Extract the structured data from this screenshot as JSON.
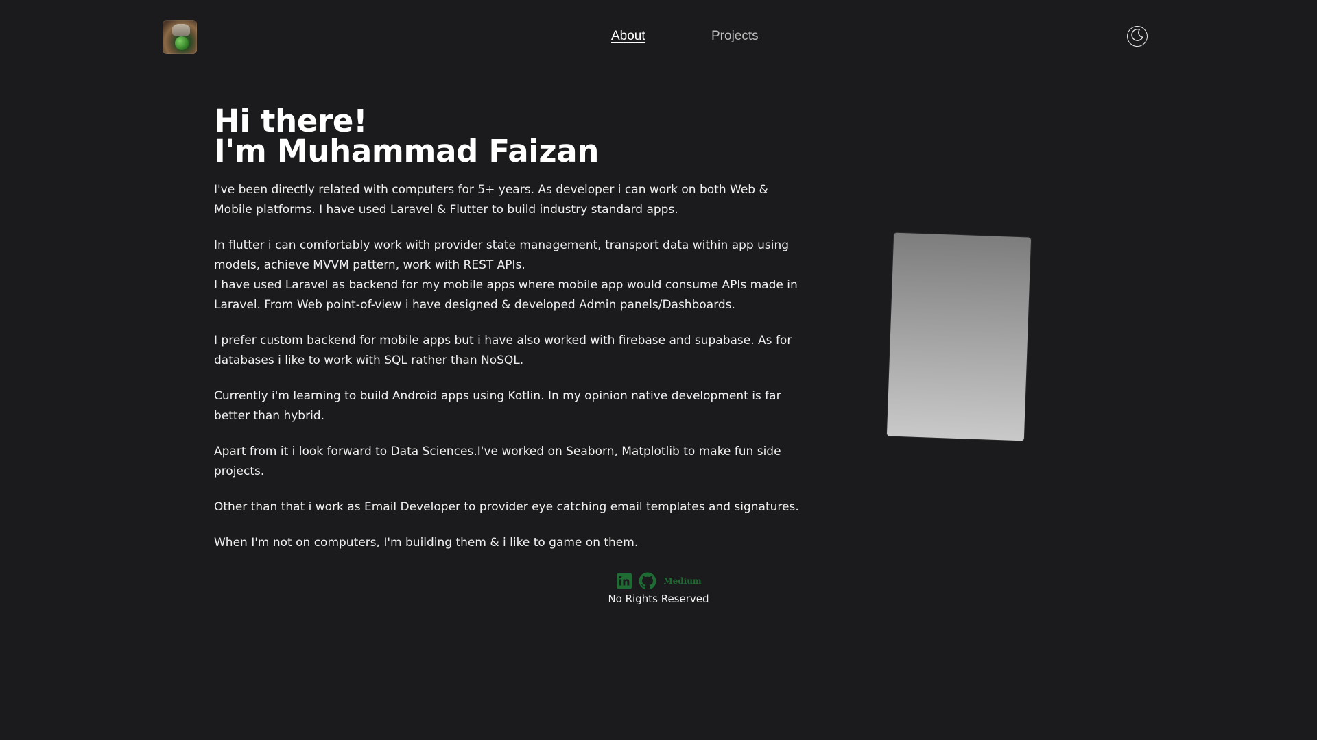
{
  "header": {
    "nav": {
      "about_label": "About",
      "projects_label": "Projects"
    }
  },
  "main": {
    "greeting_line1": "Hi there!",
    "greeting_line2": "I'm Muhammad Faizan",
    "paragraphs": [
      "I've been directly related with computers for 5+ years. As developer i can work on both Web & Mobile platforms. I have used Laravel & Flutter to build industry standard apps.",
      "In flutter i can comfortably work with provider state management, transport data within app using models, achieve MVVM pattern, work with REST APIs.",
      "I have used Laravel as backend for my mobile apps where mobile app would consume APIs made in Laravel. From Web point-of-view i have designed & developed Admin panels/Dashboards.",
      "I prefer custom backend for mobile apps but i have also worked with firebase and supabase. As for databases i like to work with SQL rather than NoSQL.",
      "Currently i'm learning to build Android apps using Kotlin. In my opinion native development is far better than hybrid.",
      "Apart from it i look forward to Data Sciences.I've worked on Seaborn, Matplotlib to make fun side projects.",
      "Other than that i work as Email Developer to provider eye catching email templates and signatures.",
      "When I'm not on computers, I'm building them & i like to game on them."
    ]
  },
  "footer": {
    "medium_label": "Medium",
    "rights": "No Rights Reserved"
  },
  "icons": {
    "theme_toggle": "moon-icon",
    "linkedin": "linkedin-icon",
    "github": "github-icon"
  },
  "colors": {
    "background": "#1b1b1d",
    "social_green": "#1f6b34",
    "text": "#ffffff"
  }
}
